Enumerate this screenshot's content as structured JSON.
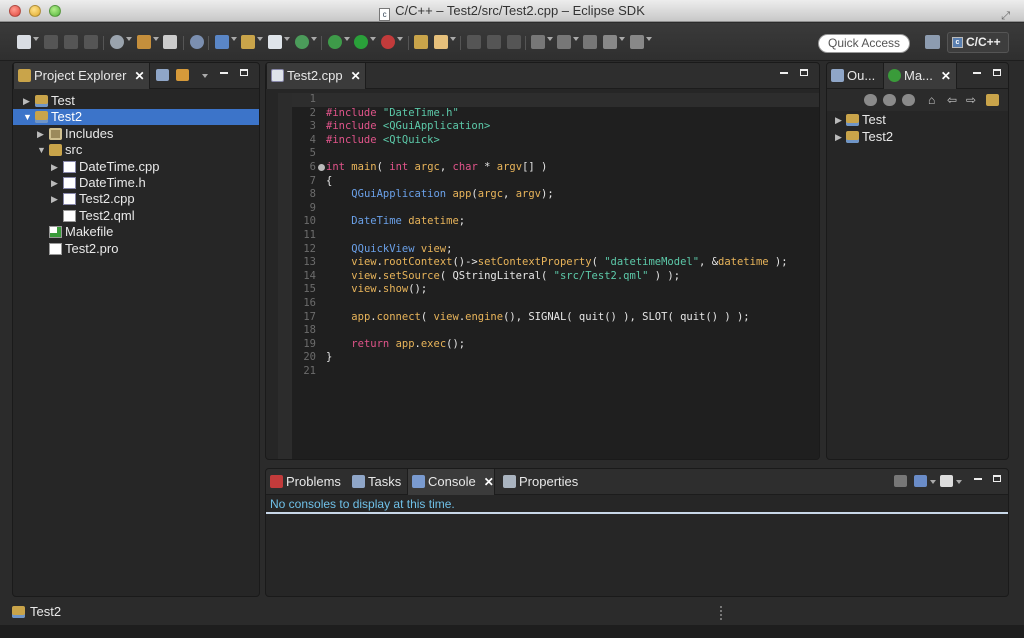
{
  "window": {
    "title": "C/C++ – Test2/src/Test2.cpp – Eclipse SDK"
  },
  "toolbar": {
    "quick_access": "Quick Access",
    "perspective": "C/C++"
  },
  "project_explorer": {
    "tab_label": "Project Explorer",
    "tree": [
      {
        "label": "Test",
        "icon": "project-icon",
        "expanded": false,
        "depth": 0
      },
      {
        "label": "Test2",
        "icon": "project-icon",
        "expanded": true,
        "depth": 0,
        "selected": true
      },
      {
        "label": "Includes",
        "icon": "includes-icon",
        "expanded": false,
        "depth": 1
      },
      {
        "label": "src",
        "icon": "folder-icon",
        "expanded": true,
        "depth": 1
      },
      {
        "label": "DateTime.cpp",
        "icon": "file-c-icon",
        "expanded": false,
        "depth": 2
      },
      {
        "label": "DateTime.h",
        "icon": "file-h-icon",
        "expanded": false,
        "depth": 2
      },
      {
        "label": "Test2.cpp",
        "icon": "file-c-icon",
        "expanded": false,
        "depth": 2
      },
      {
        "label": "Test2.qml",
        "icon": "file-plain-icon",
        "depth": 2
      },
      {
        "label": "Makefile",
        "icon": "make-icon",
        "depth": 1
      },
      {
        "label": "Test2.pro",
        "icon": "file-plain-icon",
        "depth": 1
      }
    ]
  },
  "editor": {
    "tab_label": "Test2.cpp",
    "lines": [
      "",
      "#include \"DateTime.h\"",
      "#include <QGuiApplication>",
      "#include <QtQuick>",
      "",
      "int main( int argc, char * argv[] )",
      "{",
      "    QGuiApplication app(argc, argv);",
      "",
      "    DateTime datetime;",
      "",
      "    QQuickView view;",
      "    view.rootContext()->setContextProperty( \"datetimeModel\", &datetime );",
      "    view.setSource( QStringLiteral( \"src/Test2.qml\" ) );",
      "    view.show();",
      "",
      "    app.connect( view.engine(), SIGNAL( quit() ), SLOT( quit() ) );",
      "",
      "    return app.exec();",
      "}",
      ""
    ]
  },
  "right_panel": {
    "outline_tab": "Ou...",
    "make_tab": "Ma...",
    "targets": [
      "Test",
      "Test2"
    ]
  },
  "bottom_panel": {
    "tabs": [
      "Problems",
      "Tasks",
      "Console",
      "Properties"
    ],
    "active_tab": "Console",
    "console_message": "No consoles to display at this time."
  },
  "status": {
    "selected_project": "Test2"
  }
}
